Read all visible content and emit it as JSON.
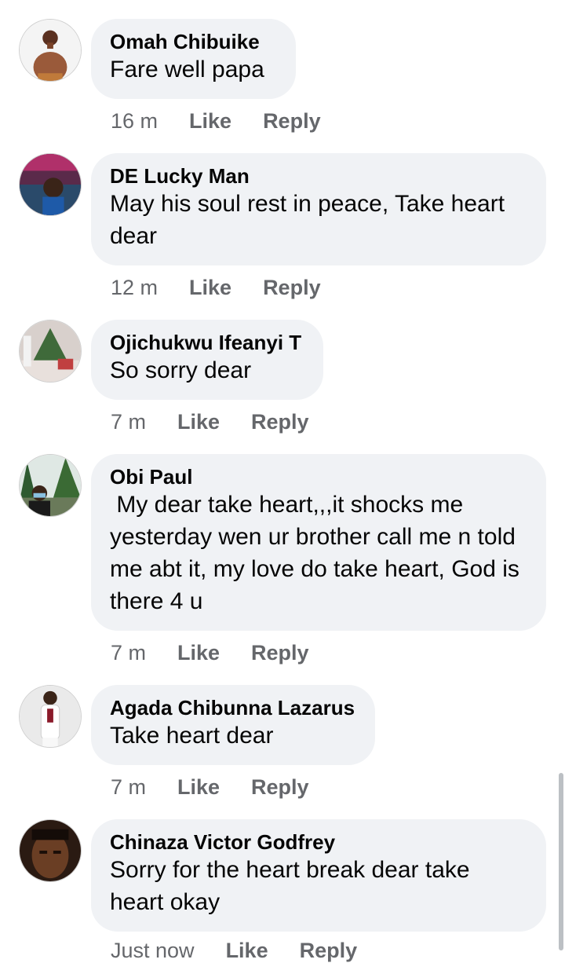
{
  "comments": [
    {
      "name": "Omah Chibuike",
      "text": "Fare well papa",
      "time": "16 m",
      "like": "Like",
      "reply": "Reply",
      "avatar_icon": "profile-photo-shirtless-man"
    },
    {
      "name": "DE Lucky Man",
      "text": "May his soul rest in peace, Take heart dear",
      "time": "12 m",
      "like": "Like",
      "reply": "Reply",
      "avatar_icon": "profile-photo-man-crowd"
    },
    {
      "name": "Ojichukwu Ifeanyi T",
      "text": "So sorry dear",
      "time": "7 m",
      "like": "Like",
      "reply": "Reply",
      "avatar_icon": "profile-photo-tree"
    },
    {
      "name": "Obi Paul",
      "text": " My dear take heart,,,it shocks me yesterday wen ur brother call me n told me abt it, my love do take heart, God is there 4 u",
      "time": "7 m",
      "like": "Like",
      "reply": "Reply",
      "avatar_icon": "profile-photo-man-masked-outdoors"
    },
    {
      "name": "Agada Chibunna Lazarus",
      "text": "Take heart dear",
      "time": "7 m",
      "like": "Like",
      "reply": "Reply",
      "avatar_icon": "profile-photo-man-white-outfit"
    },
    {
      "name": "Chinaza Victor Godfrey",
      "text": "Sorry for the heart break dear take heart okay",
      "time": "Just now",
      "like": "Like",
      "reply": "Reply",
      "avatar_icon": "profile-photo-man-closeup"
    }
  ],
  "colors": {
    "bubble": "#f0f2f5",
    "meta": "#65676b",
    "text": "#050505"
  }
}
